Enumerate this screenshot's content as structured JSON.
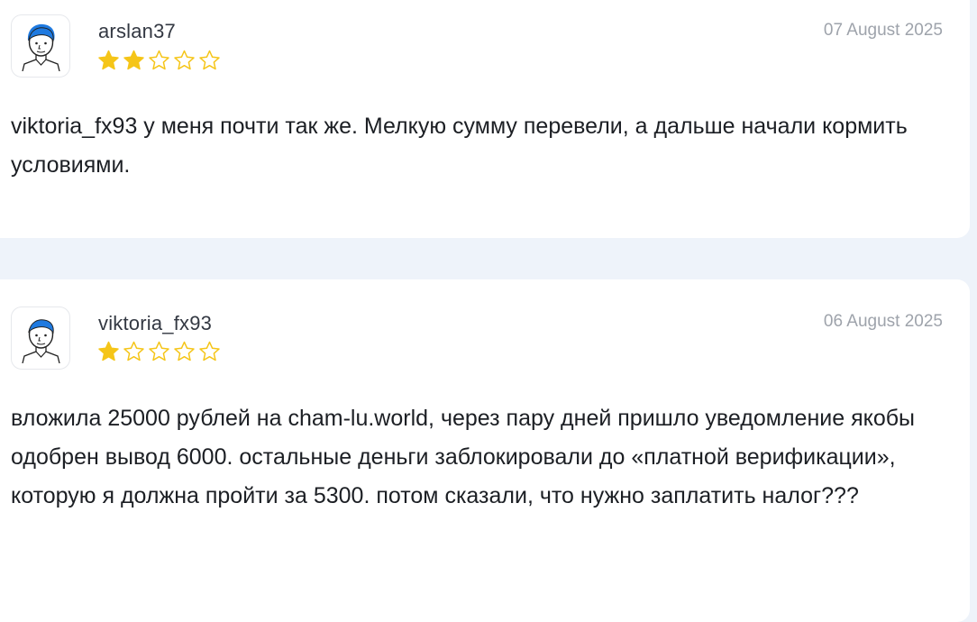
{
  "reviews": [
    {
      "username": "arslan37",
      "date": "07 August 2025",
      "rating": 2,
      "max_rating": 5,
      "text": "viktoria_fx93 у меня почти так же. Мелкую сумму перевели, а дальше начали кормить условиями.",
      "avatar_icon": "user-avatar-icon"
    },
    {
      "username": "viktoria_fx93",
      "date": "06 August 2025",
      "rating": 1,
      "max_rating": 5,
      "text": "вложила 25000 рублей на cham-lu.world, через пару дней пришло уведомление якобы одобрен вывод 6000. остальные деньги заблокировали до «платной верификации», которую я должна пройти за 5300. потом сказали, что нужно заплатить налог???",
      "avatar_icon": "user-avatar-icon"
    }
  ],
  "colors": {
    "page_background": "#eef3fa",
    "card_background": "#ffffff",
    "star_filled": "#f5c518",
    "star_empty_outline": "#f5c518",
    "username": "#333842",
    "date": "#9ea3ab",
    "text": "#1c1f24",
    "avatar_hair": "#1f7ae0"
  }
}
